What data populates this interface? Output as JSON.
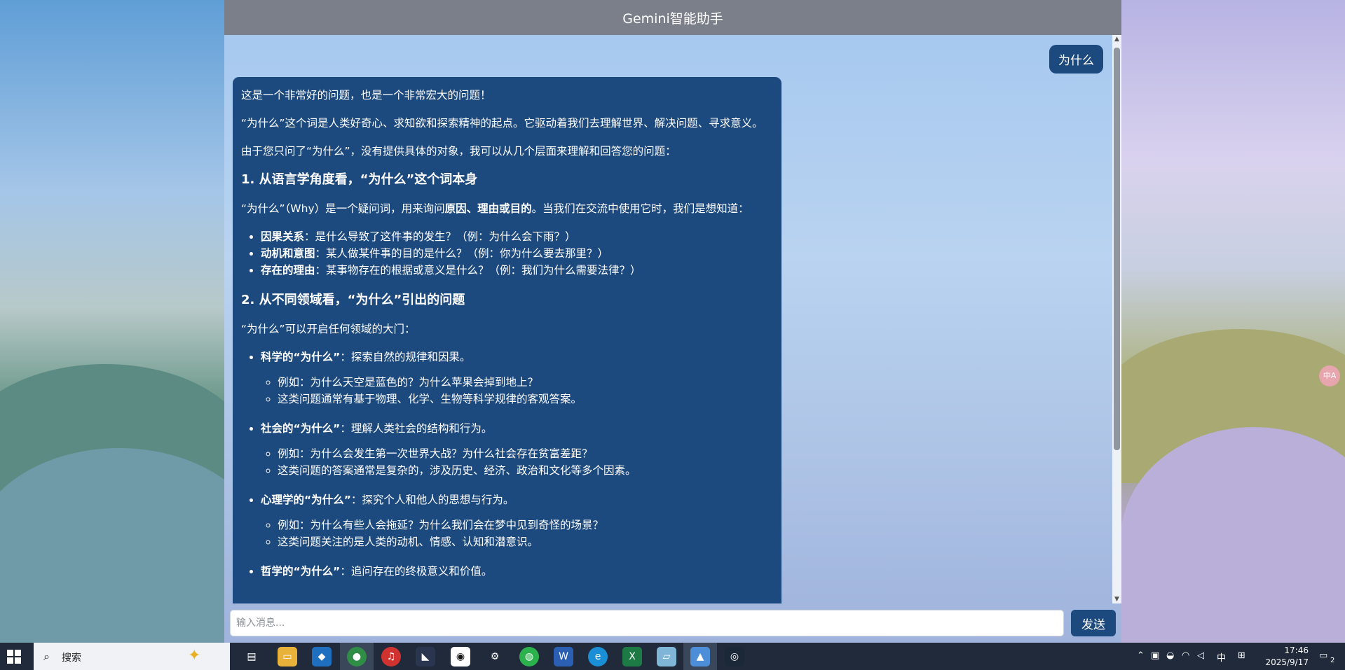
{
  "app": {
    "title": "Gemini智能助手"
  },
  "chat": {
    "user_message": "为什么",
    "bot": {
      "p1": "这是一个非常好的问题，也是一个非常宏大的问题！",
      "p2": "“为什么”这个词是人类好奇心、求知欲和探索精神的起点。它驱动着我们去理解世界、解决问题、寻求意义。",
      "p3": "由于您只问了“为什么”，没有提供具体的对象，我可以从几个层面来理解和回答您的问题：",
      "h1": "1. 从语言学角度看，“为什么”这个词本身",
      "s1_intro_a": "“为什么”（Why）是一个疑问词，用来询问",
      "s1_intro_b": "原因、理由或目的",
      "s1_intro_c": "。当我们在交流中使用它时，我们是想知道：",
      "s1_items": [
        {
          "term": "因果关系",
          "text": "：是什么导致了这件事的发生？（例：为什么会下雨？）"
        },
        {
          "term": "动机和意图",
          "text": "：某人做某件事的目的是什么？（例：你为什么要去那里？）"
        },
        {
          "term": "存在的理由",
          "text": "：某事物存在的根据或意义是什么？（例：我们为什么需要法律？）"
        }
      ],
      "h2": "2. 从不同领域看，“为什么”引出的问题",
      "s2_intro": "“为什么”可以开启任何领域的大门：",
      "s2_items": [
        {
          "term": "科学的“为什么”",
          "text": "：探索自然的规律和因果。",
          "sub": [
            "例如：为什么天空是蓝色的？为什么苹果会掉到地上？",
            "这类问题通常有基于物理、化学、生物等科学规律的客观答案。"
          ]
        },
        {
          "term": "社会的“为什么”",
          "text": "：理解人类社会的结构和行为。",
          "sub": [
            "例如：为什么会发生第一次世界大战？为什么社会存在贫富差距？",
            "这类问题的答案通常是复杂的，涉及历史、经济、政治和文化等多个因素。"
          ]
        },
        {
          "term": "心理学的“为什么”",
          "text": "：探究个人和他人的思想与行为。",
          "sub": [
            "例如：为什么有些人会拖延？为什么我们会在梦中见到奇怪的场景？",
            "这类问题关注的是人类的动机、情感、认知和潜意识。"
          ]
        },
        {
          "term": "哲学的“为什么”",
          "text": "：追问存在的终极意义和价值。"
        }
      ]
    }
  },
  "input": {
    "placeholder": "输入消息...",
    "send_label": "发送"
  },
  "overlay": {
    "translate_badge": "中A"
  },
  "taskbar": {
    "search_label": "搜索",
    "ime_lang": "中",
    "time": "17:46",
    "date": "2025/9/17",
    "notification_count": "2"
  }
}
